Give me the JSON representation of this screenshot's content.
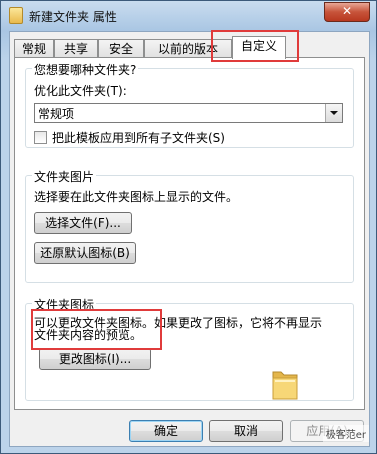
{
  "window": {
    "title": "新建文件夹 属性",
    "close_label": "✕"
  },
  "tabs": [
    "常规",
    "共享",
    "安全",
    "以前的版本",
    "自定义"
  ],
  "active_tab": "自定义",
  "optimize_group": {
    "title": "您想要哪种文件夹?",
    "optimize_label": "优化此文件夹(T):",
    "optimize_value": "常规项",
    "apply_subfolders_label": "把此模板应用到所有子文件夹(S)",
    "apply_subfolders_checked": false
  },
  "picture_group": {
    "title": "文件夹图片",
    "description": "选择要在此文件夹图标上显示的文件。",
    "choose_file_button": "选择文件(F)...",
    "restore_default_button": "还原默认图标(B)"
  },
  "icon_group": {
    "title": "文件夹图标",
    "description_line1": "可以更改文件夹图标。如果更改了图标，它将不再显示",
    "description_line2": "文件夹内容的预览。",
    "change_icon_button": "更改图标(I)..."
  },
  "footer": {
    "ok_button": "确定",
    "cancel_button": "取消",
    "apply_button": "应用(A)"
  },
  "watermark": "极客范er",
  "colors": {
    "highlight": "#e03b3b",
    "default_button_border": "#3c7fb1"
  }
}
